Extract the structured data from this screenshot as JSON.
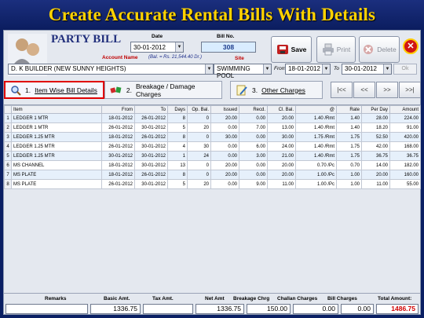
{
  "banner": {
    "title": "Create Accurate Rental Bills With Details"
  },
  "header": {
    "title": "PARTY BILL",
    "account_label": "Account Name",
    "balance_note": "(Bal. = Rs. 21,544.40 Dr.)",
    "date_label": "Date",
    "date_value": "30-01-2012",
    "bill_no_label": "Bill No.",
    "bill_no_value": "308",
    "site_label": "Site",
    "account_value": "D. K BUILDER (NEW SUNNY HEIGHTS)",
    "site_value": "SWIMMING POOL",
    "from_label": "From",
    "from_value": "18-01-2012",
    "to_label": "To",
    "to_value": "30-01-2012",
    "ok_label": "Ok"
  },
  "toolbar": {
    "save_label": "Save",
    "print_label": "Print",
    "delete_label": "Delete"
  },
  "tabs": [
    {
      "num": "1.",
      "label": "Item Wise Bill Details"
    },
    {
      "num": "2.",
      "label": "Breakage / Damage Charges"
    },
    {
      "num": "3.",
      "label": "Other Charges"
    }
  ],
  "nav": {
    "first": "|<<",
    "prev": "<<",
    "next": ">>",
    "last": ">>|"
  },
  "table": {
    "columns": [
      "Item",
      "From",
      "To",
      "Days",
      "Op. Bal.",
      "Issued",
      "Recd.",
      "Cl. Bal.",
      "@",
      "Rate",
      "Per Day",
      "Amount"
    ],
    "rows": [
      [
        "1",
        "LEDGER 1 MTR",
        "18-01-2012",
        "26-01-2012",
        "8",
        "0",
        "20.00",
        "0.00",
        "20.00",
        "1.40 /Rmt",
        "1.40",
        "28.00",
        "224.00"
      ],
      [
        "2",
        "LEDGER 1 MTR",
        "26-01-2012",
        "30-01-2012",
        "5",
        "20",
        "0.00",
        "7.00",
        "13.00",
        "1.40 /Rmt",
        "1.40",
        "18.20",
        "91.00"
      ],
      [
        "3",
        "LEDGER 1.25 MTR",
        "18-01-2012",
        "26-01-2012",
        "8",
        "0",
        "30.00",
        "0.00",
        "30.00",
        "1.75 /Rmt",
        "1.75",
        "52.50",
        "420.00"
      ],
      [
        "4",
        "LEDGER 1.25 MTR",
        "26-01-2012",
        "30-01-2012",
        "4",
        "30",
        "0.00",
        "6.00",
        "24.00",
        "1.40 /Rmt",
        "1.75",
        "42.00",
        "168.00"
      ],
      [
        "5",
        "LEDGER 1.25 MTR",
        "30-01-2012",
        "30-01-2012",
        "1",
        "24",
        "0.00",
        "3.00",
        "21.00",
        "1.40 /Rmt",
        "1.75",
        "36.75",
        "36.75"
      ],
      [
        "6",
        "MS CHANNEL",
        "18-01-2012",
        "30-01-2012",
        "13",
        "0",
        "20.00",
        "0.00",
        "20.00",
        "0.70 /Pc",
        "0.70",
        "14.00",
        "182.00"
      ],
      [
        "7",
        "MS PLATE",
        "18-01-2012",
        "26-01-2012",
        "8",
        "0",
        "20.00",
        "0.00",
        "20.00",
        "1.00 /Pc",
        "1.00",
        "20.00",
        "160.00"
      ],
      [
        "8",
        "MS PLATE",
        "26-01-2012",
        "30-01-2012",
        "5",
        "20",
        "0.00",
        "9.00",
        "11.00",
        "1.00 /Pc",
        "1.00",
        "11.00",
        "55.00"
      ]
    ]
  },
  "footer": {
    "remarks_label": "Remarks",
    "basic_label": "Basic Amt.",
    "basic_value": "1336.75",
    "tax_label": "Tax Amt.",
    "tax_value": "",
    "net_label": "Net Amt",
    "net_value": "1336.75",
    "breakage_label": "Breakage Chrg",
    "breakage_value": "150.00",
    "challan_label": "Challan Charges",
    "challan_value": "0.00",
    "bill_label": "Bill Charges",
    "bill_value": "0.00",
    "total_label": "Total Amount:",
    "total_value": "1486.75"
  }
}
